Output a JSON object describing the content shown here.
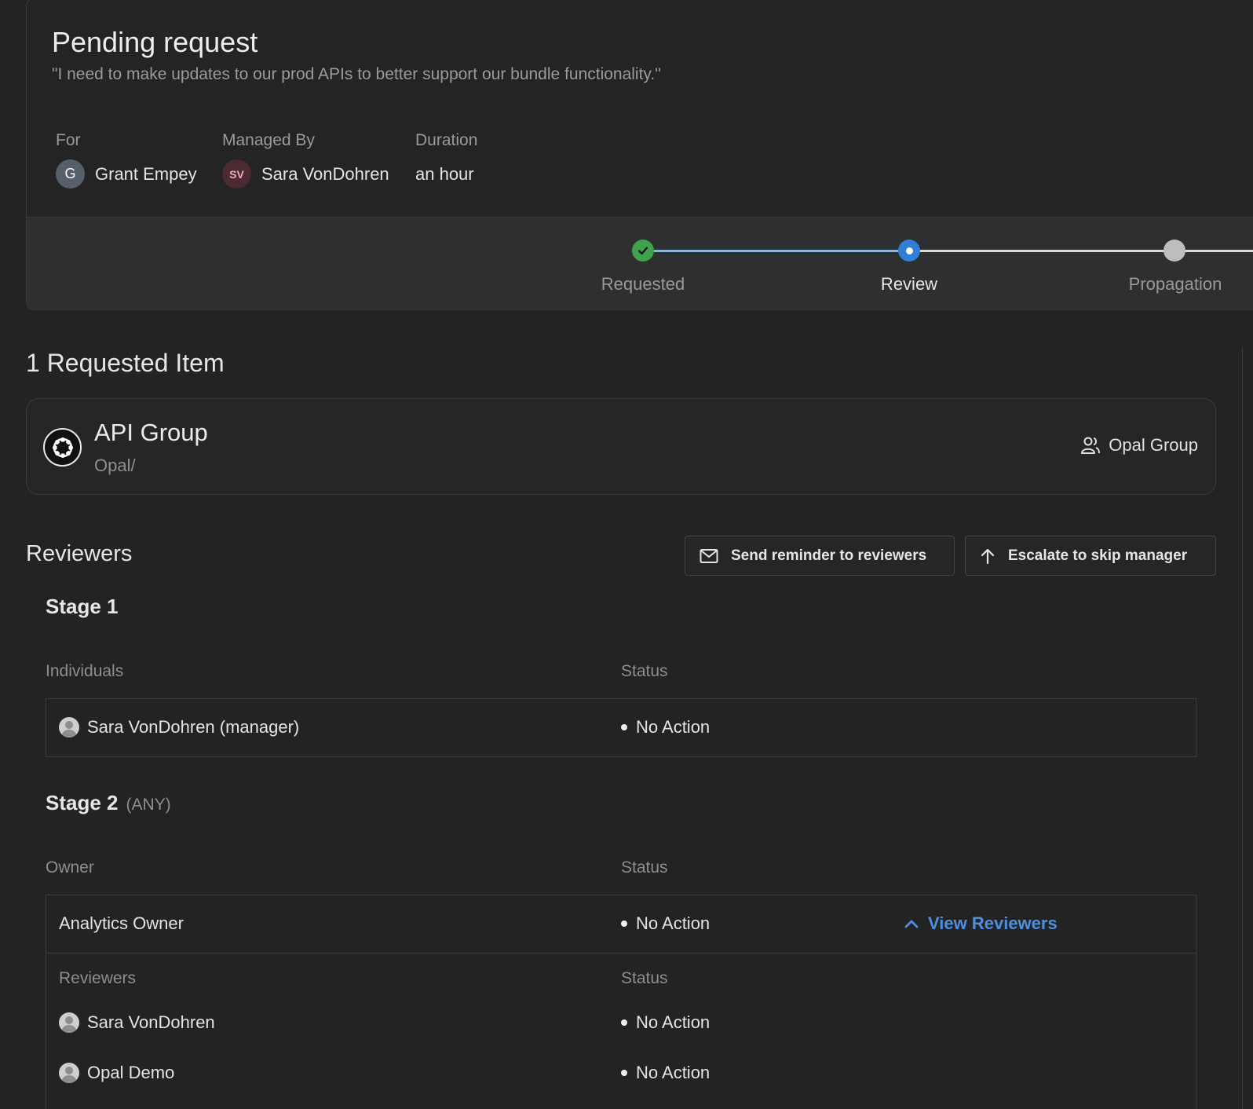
{
  "header": {
    "title": "Pending request",
    "reason": "\"I need to make updates to our prod APIs to better support our bundle functionality.\"",
    "for_label": "For",
    "for_avatar": "G",
    "for_name": "Grant Empey",
    "managed_label": "Managed By",
    "managed_avatar": "SV",
    "managed_name": "Sara VonDohren",
    "duration_label": "Duration",
    "duration_value": "an hour"
  },
  "progress": {
    "steps": [
      {
        "label": "Requested",
        "state": "complete"
      },
      {
        "label": "Review",
        "state": "current"
      },
      {
        "label": "Propagation",
        "state": "pending"
      }
    ],
    "colors": {
      "complete": "#3fa34d",
      "current": "#2f7fd6",
      "pending": "#bdbdbd",
      "line_done": "#8eb4db",
      "line_todo": "#d9d9d9"
    }
  },
  "requested": {
    "title": "1 Requested Item",
    "item_name": "API Group",
    "item_path": "Opal/",
    "item_icon": "opal-logo-icon",
    "item_type": "Opal Group",
    "item_type_icon": "users-icon"
  },
  "reviewers": {
    "title": "Reviewers",
    "send_reminder": "Send reminder to reviewers",
    "send_reminder_icon": "mail-icon",
    "escalate": "Escalate to skip manager",
    "escalate_icon": "arrow-up-icon",
    "stage1": {
      "title": "Stage 1",
      "col_individuals": "Individuals",
      "col_status": "Status",
      "rows": [
        {
          "name": "Sara VonDohren (manager)",
          "status": "No Action"
        }
      ]
    },
    "stage2": {
      "title": "Stage 2",
      "mode": "(ANY)",
      "col_owner": "Owner",
      "col_status": "Status",
      "owner_row": {
        "name": "Analytics Owner",
        "status": "No Action",
        "action": "View Reviewers",
        "action_icon": "chevron-up-icon"
      },
      "sub_col_reviewers": "Reviewers",
      "sub_col_status": "Status",
      "sub_rows": [
        {
          "name": "Sara VonDohren",
          "status": "No Action"
        },
        {
          "name": "Opal Demo",
          "status": "No Action"
        }
      ]
    }
  }
}
